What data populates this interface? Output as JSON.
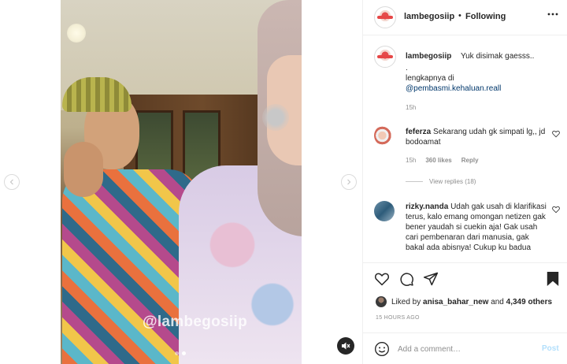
{
  "video": {
    "watermark": "@lambegosiip",
    "nav_prev_icon": "chevron-left-icon",
    "nav_next_icon": "chevron-right-icon",
    "mute_icon": "speaker-muted-icon",
    "carousel": {
      "count": 2,
      "active_index": 1
    }
  },
  "header": {
    "username": "lambegosiip",
    "separator": "•",
    "follow_status": "Following",
    "more_icon": "more-horizontal-icon"
  },
  "caption": {
    "username": "lambegosiip",
    "text": "Yuk disimak gaesss..",
    "dot_line": ".",
    "line3": "lengkapnya di",
    "mention": "@pembasmi.kehaluan.reall",
    "time": "15h"
  },
  "comments": [
    {
      "username": "feferza",
      "text": "Sekarang udah gk simpati lg,, jd bodoamat",
      "time": "15h",
      "likes": "360 likes",
      "reply_label": "Reply",
      "view_replies": "View replies (18)"
    },
    {
      "username": "rizky.nanda",
      "text": "Udah gak usah di klarifikasi terus, kalo emang omongan netizen gak bener yaudah si cuekin aja! Gak usah cari pembenaran dari manusia, gak bakal ada abisnya! Cukup ku badua"
    }
  ],
  "actions": {
    "like_icon": "heart-icon",
    "comment_icon": "comment-icon",
    "share_icon": "send-icon",
    "save_icon": "bookmark-icon"
  },
  "likes": {
    "prefix": "Liked by",
    "user": "anisa_bahar_new",
    "middle": "and",
    "others": "4,349 others"
  },
  "post_time": "15 HOURS AGO",
  "add_comment": {
    "emoji_icon": "emoji-icon",
    "placeholder": "Add a comment…",
    "post_label": "Post"
  }
}
